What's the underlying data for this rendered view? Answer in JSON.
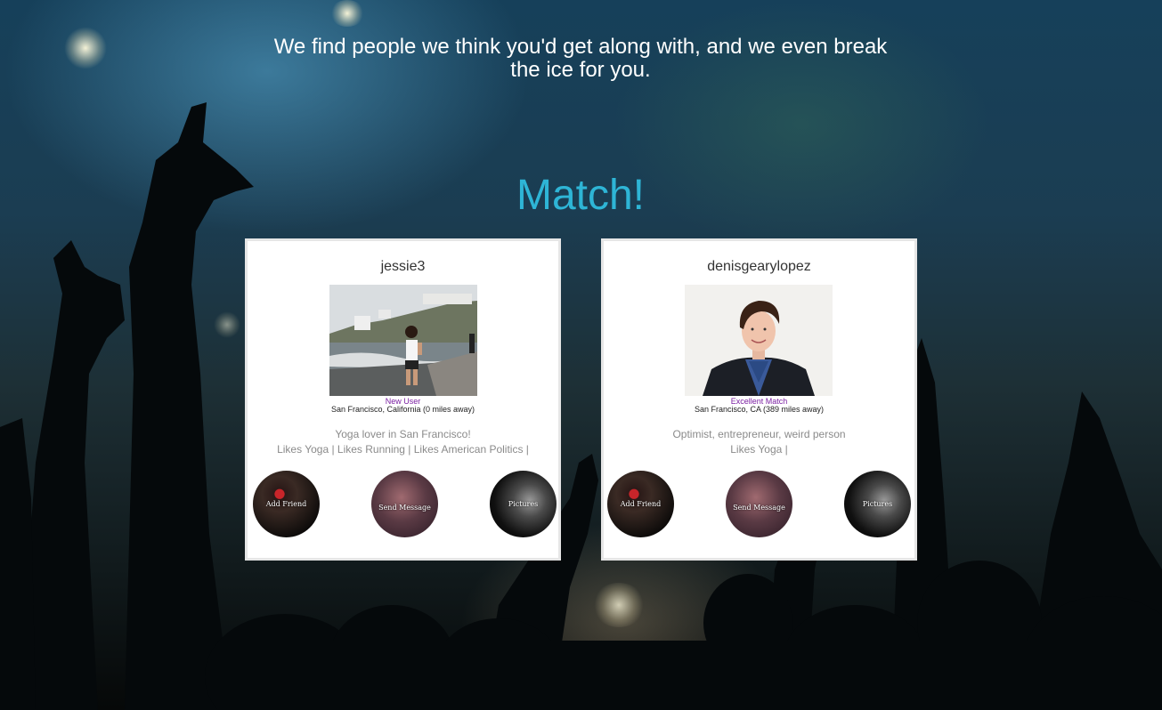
{
  "hero": {
    "tagline": "We find people we think you'd get along with, and we even break the ice for you.",
    "title": "Match!"
  },
  "colors": {
    "accent": "#2eb5d6",
    "status": "#7a1fa2",
    "card_bg": "#ffffff"
  },
  "cards": [
    {
      "username": "jessie3",
      "status": "New User",
      "location": "San Francisco, California (0 miles away)",
      "bio": "Yoga lover in San Francisco!",
      "likes": "Likes Yoga | Likes Running | Likes American Politics |",
      "actions": {
        "add_friend": "Add Friend",
        "send_message": "Send Message",
        "pictures": "Pictures"
      }
    },
    {
      "username": "denisgearylopez",
      "status": "Excellent Match",
      "location": "San Francisco, CA (389 miles away)",
      "bio": "Optimist, entrepreneur, weird person",
      "likes": "Likes Yoga |",
      "actions": {
        "add_friend": "Add Friend",
        "send_message": "Send Message",
        "pictures": "Pictures"
      }
    }
  ]
}
